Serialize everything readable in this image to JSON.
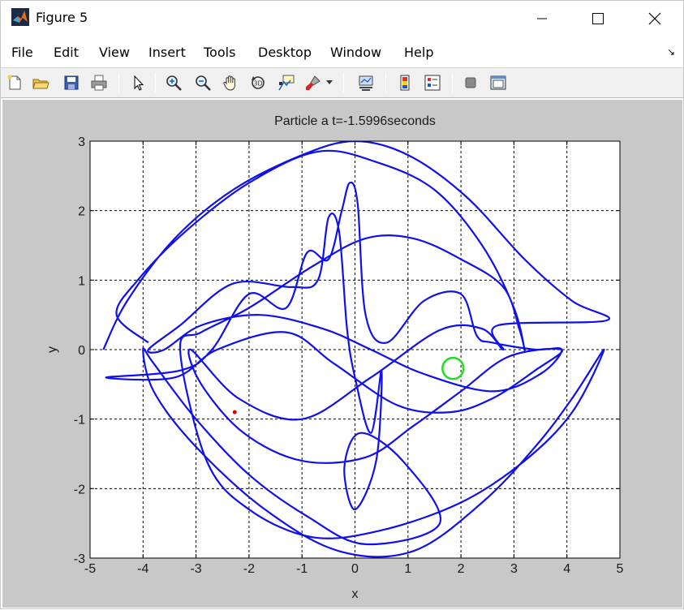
{
  "window": {
    "title": "Figure 5",
    "minimize_icon": "minimize-icon",
    "maximize_icon": "maximize-icon",
    "close_icon": "close-icon"
  },
  "menu": {
    "items": [
      "File",
      "Edit",
      "View",
      "Insert",
      "Tools",
      "Desktop",
      "Window",
      "Help"
    ],
    "dock_glyph": "↘"
  },
  "toolbar": {
    "icons": [
      "new-figure-icon",
      "open-file-icon",
      "save-icon",
      "print-icon",
      "edit-plot-arrow-icon",
      "zoom-in-icon",
      "zoom-out-icon",
      "pan-hand-icon",
      "rotate-3d-icon",
      "data-cursor-icon",
      "brush-icon",
      "brush-dropdown-icon",
      "link-plot-icon",
      "colorbar-icon",
      "legend-icon",
      "hide-plot-tools-icon",
      "show-plot-tools-icon"
    ]
  },
  "chart_data": {
    "type": "line",
    "title": "Particle a t=-1.5996seconds",
    "xlabel": "x",
    "ylabel": "y",
    "xlim": [
      -5,
      5
    ],
    "ylim": [
      -3,
      3
    ],
    "xticks": [
      "-5",
      "-4",
      "-3",
      "-2",
      "-1",
      "0",
      "1",
      "2",
      "3",
      "4",
      "5"
    ],
    "yticks": [
      "3",
      "2",
      "1",
      "0",
      "-1",
      "-2",
      "-3"
    ],
    "grid": true,
    "colors": {
      "trajectory": "#1010ee",
      "marker_circle": "#22dd22",
      "marker_dot": "#dd0000",
      "background": "#ffffff"
    },
    "trajectory": [
      [
        -4.75,
        0.0
      ],
      [
        -4.3,
        0.7
      ],
      [
        -3.4,
        1.6
      ],
      [
        -2.3,
        2.3
      ],
      [
        -1.0,
        2.8
      ],
      [
        0.0,
        3.0
      ],
      [
        1.0,
        2.8
      ],
      [
        2.1,
        2.2
      ],
      [
        3.2,
        1.3
      ],
      [
        4.1,
        0.7
      ],
      [
        4.75,
        0.42
      ],
      [
        2.7,
        0.35
      ],
      [
        2.8,
        0.0
      ],
      [
        2.4,
        0.3
      ],
      [
        1.6,
        0.28
      ],
      [
        0.3,
        -0.4
      ],
      [
        -1.0,
        -1.0
      ],
      [
        -2.2,
        -0.7
      ],
      [
        -3.1,
        0.0
      ],
      [
        -2.9,
        -0.5
      ],
      [
        -2.1,
        -1.2
      ],
      [
        -1.0,
        -1.6
      ],
      [
        0.2,
        -1.55
      ],
      [
        1.1,
        -1.1
      ],
      [
        2.0,
        -0.6
      ],
      [
        2.9,
        -0.1
      ],
      [
        3.9,
        0.0
      ],
      [
        3.4,
        -0.3
      ],
      [
        2.6,
        -0.7
      ],
      [
        1.8,
        -0.9
      ],
      [
        0.8,
        -0.8
      ],
      [
        -0.4,
        -0.2
      ],
      [
        -1.3,
        0.25
      ],
      [
        -2.6,
        0.0
      ],
      [
        -3.4,
        -0.4
      ],
      [
        -4.7,
        -0.4
      ],
      [
        -3.3,
        -0.3
      ],
      [
        -2.7,
        0.0
      ],
      [
        -2.0,
        0.8
      ],
      [
        -1.3,
        0.6
      ],
      [
        -0.9,
        1.4
      ],
      [
        -0.5,
        1.3
      ],
      [
        -0.25,
        2.0
      ],
      [
        -0.1,
        2.4
      ],
      [
        0.05,
        2.1
      ],
      [
        0.2,
        0.5
      ],
      [
        0.6,
        0.1
      ],
      [
        1.3,
        0.7
      ],
      [
        2.0,
        0.8
      ],
      [
        2.3,
        0.2
      ],
      [
        2.6,
        0.1
      ],
      [
        3.4,
        0.0
      ],
      [
        3.9,
        0.0
      ],
      [
        3.5,
        -0.35
      ],
      [
        2.6,
        -0.6
      ],
      [
        1.3,
        -0.35
      ],
      [
        0.3,
        0.0
      ],
      [
        -0.6,
        0.3
      ],
      [
        -1.8,
        0.5
      ],
      [
        -2.9,
        0.35
      ],
      [
        -3.6,
        0.0
      ],
      [
        -3.9,
        0.0
      ],
      [
        -3.3,
        0.35
      ],
      [
        -2.3,
        0.95
      ],
      [
        -1.2,
        0.9
      ],
      [
        -0.7,
        1.0
      ],
      [
        -0.5,
        1.9
      ],
      [
        -0.3,
        1.7
      ],
      [
        -0.15,
        0.3
      ],
      [
        0.0,
        -0.4
      ],
      [
        0.3,
        -1.2
      ],
      [
        0.5,
        -0.3
      ],
      [
        0.4,
        -1.6
      ],
      [
        0.0,
        -2.3
      ],
      [
        -0.2,
        -1.7
      ],
      [
        0.1,
        -1.2
      ],
      [
        0.9,
        -1.6
      ],
      [
        1.6,
        -2.5
      ],
      [
        0.2,
        -2.8
      ],
      [
        -0.9,
        -2.4
      ],
      [
        -2.0,
        -1.8
      ],
      [
        -3.0,
        -1.0
      ],
      [
        -3.8,
        -0.2
      ],
      [
        -4.0,
        0.0
      ],
      [
        -3.8,
        -0.6
      ],
      [
        -3.0,
        -1.4
      ],
      [
        -1.7,
        -2.3
      ],
      [
        -0.3,
        -2.9
      ],
      [
        1.1,
        -2.9
      ],
      [
        2.4,
        -2.2
      ],
      [
        3.4,
        -1.4
      ],
      [
        4.1,
        -0.7
      ],
      [
        4.7,
        0.0
      ],
      [
        4.1,
        -0.9
      ],
      [
        3.2,
        -1.6
      ],
      [
        2.0,
        -2.2
      ],
      [
        0.5,
        -2.6
      ],
      [
        -0.8,
        -2.7
      ],
      [
        -2.0,
        -2.3
      ],
      [
        -2.8,
        -1.6
      ],
      [
        -3.3,
        0.0
      ],
      [
        -2.9,
        0.25
      ],
      [
        -2.0,
        0.6
      ],
      [
        -0.8,
        1.2
      ],
      [
        0.2,
        1.6
      ],
      [
        1.1,
        1.6
      ],
      [
        2.0,
        1.3
      ],
      [
        2.8,
        0.9
      ],
      [
        3.1,
        0.3
      ],
      [
        3.2,
        0.0
      ],
      [
        3.0,
        0.6
      ],
      [
        2.4,
        1.5
      ],
      [
        1.5,
        2.3
      ],
      [
        0.4,
        2.7
      ],
      [
        -0.7,
        2.85
      ],
      [
        -2.0,
        2.4
      ],
      [
        -3.2,
        1.7
      ],
      [
        -4.1,
        1.0
      ],
      [
        -4.5,
        0.5
      ],
      [
        -3.9,
        0.1
      ]
    ],
    "markers": [
      {
        "name": "circle",
        "x": 1.85,
        "y": -0.27
      },
      {
        "name": "dot",
        "x": -2.27,
        "y": -0.9
      }
    ]
  }
}
